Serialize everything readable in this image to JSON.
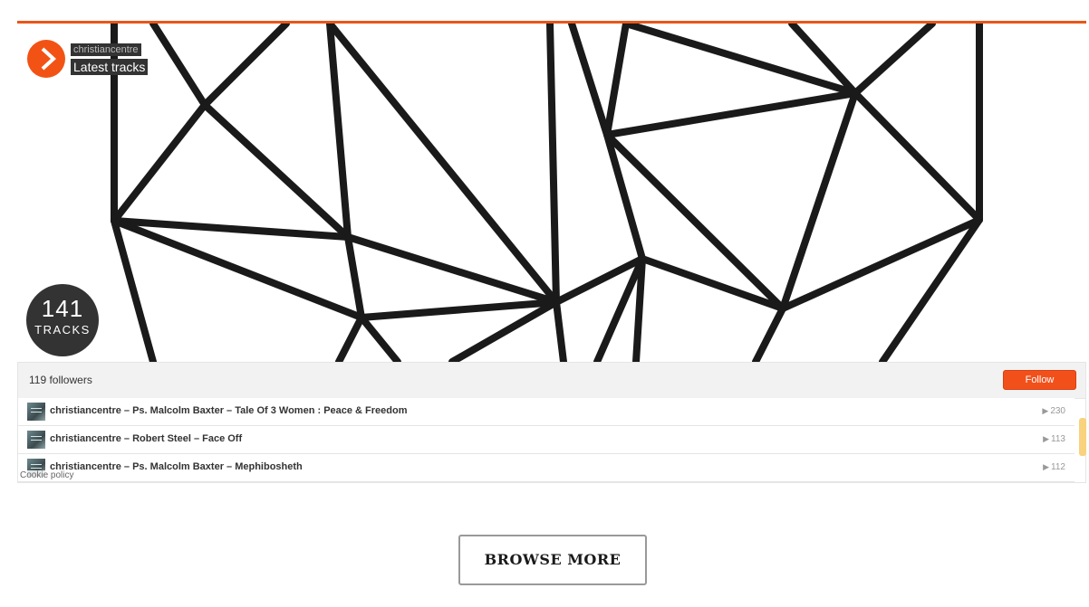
{
  "widget": {
    "user": "christiancentre",
    "title": "Latest tracks",
    "track_count": "141",
    "track_count_label": "TRACKS",
    "followers": "119 followers",
    "follow_label": "Follow",
    "cookie_policy": "Cookie policy",
    "accent_color": "#f25314",
    "tracks": [
      {
        "title": "christiancentre – Ps. Malcolm Baxter – Tale Of 3 Women : Peace & Freedom",
        "plays": "230"
      },
      {
        "title": "christiancentre – Robert Steel – Face Off",
        "plays": "113"
      },
      {
        "title": "christiancentre – Ps. Malcolm Baxter – Mephibosheth",
        "plays": "112"
      }
    ]
  },
  "browse_more": "BROWSE MORE"
}
